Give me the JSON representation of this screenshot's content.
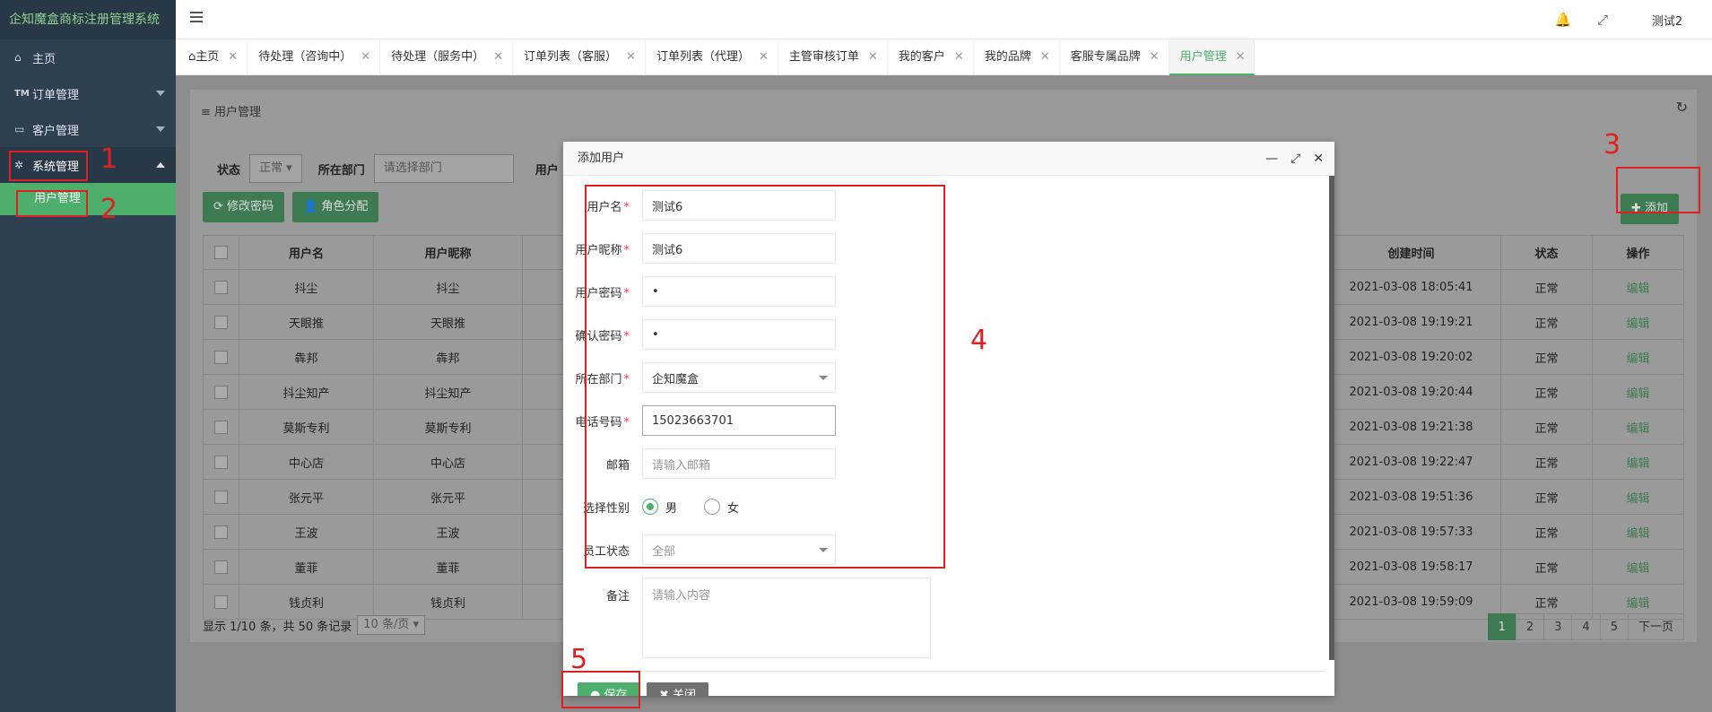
{
  "app": {
    "title": "企知魔盒商标注册管理系统"
  },
  "sidebar": {
    "items": [
      {
        "label": "主页",
        "icon": "home-icon"
      },
      {
        "label": "订单管理",
        "icon": "tm-icon",
        "glyph": "TM"
      },
      {
        "label": "客户管理",
        "icon": "monitor-icon"
      },
      {
        "label": "系统管理",
        "icon": "gear-icon"
      }
    ],
    "subitems": [
      {
        "label": "用户管理"
      }
    ]
  },
  "topbar": {
    "user": "测试2",
    "icons": [
      "bell-icon",
      "fullscreen-icon"
    ]
  },
  "tabs": [
    {
      "label": "主页",
      "icon": "home-icon"
    },
    {
      "label": "待处理（咨询中）"
    },
    {
      "label": "待处理（服务中）"
    },
    {
      "label": "订单列表（客服）"
    },
    {
      "label": "订单列表（代理）"
    },
    {
      "label": "主管审核订单"
    },
    {
      "label": "我的客户"
    },
    {
      "label": "我的品牌"
    },
    {
      "label": "客服专属品牌"
    },
    {
      "label": "用户管理",
      "active": true
    }
  ],
  "panel": {
    "title": "用户管理",
    "filters": {
      "status_label": "状态",
      "status_value": "正常",
      "dept_label": "所在部门",
      "dept_placeholder": "请选择部门",
      "user_label": "用户"
    },
    "buttons": {
      "change_password": "修改密码",
      "assign_role": "角色分配",
      "add": "添加"
    },
    "table": {
      "headers": {
        "username": "用户名",
        "nickname": "用户昵称",
        "created": "创建时间",
        "status": "状态",
        "action": "操作"
      },
      "rows": [
        {
          "username": "抖尘",
          "nickname": "抖尘",
          "created": "2021-03-08 18:05:41",
          "status": "正常",
          "action": "编辑"
        },
        {
          "username": "天眼推",
          "nickname": "天眼推",
          "created": "2021-03-08 19:19:21",
          "status": "正常",
          "action": "编辑"
        },
        {
          "username": "犇邦",
          "nickname": "犇邦",
          "created": "2021-03-08 19:20:02",
          "status": "正常",
          "action": "编辑"
        },
        {
          "username": "抖尘知产",
          "nickname": "抖尘知产",
          "created": "2021-03-08 19:20:44",
          "status": "正常",
          "action": "编辑"
        },
        {
          "username": "莫斯专利",
          "nickname": "莫斯专利",
          "created": "2021-03-08 19:21:38",
          "status": "正常",
          "action": "编辑"
        },
        {
          "username": "中心店",
          "nickname": "中心店",
          "created": "2021-03-08 19:22:47",
          "status": "正常",
          "action": "编辑"
        },
        {
          "username": "张元平",
          "nickname": "张元平",
          "created": "2021-03-08 19:51:36",
          "status": "正常",
          "action": "编辑"
        },
        {
          "username": "王波",
          "nickname": "王波",
          "created": "2021-03-08 19:57:33",
          "status": "正常",
          "action": "编辑"
        },
        {
          "username": "董菲",
          "nickname": "董菲",
          "created": "2021-03-08 19:58:17",
          "status": "正常",
          "action": "编辑"
        },
        {
          "username": "钱贞利",
          "nickname": "钱贞利",
          "created": "2021-03-08 19:59:09",
          "status": "正常",
          "action": "编辑"
        }
      ]
    },
    "footer": {
      "info": "显示 1/10 条，共 50 条记录",
      "page_size": "10 条/页"
    },
    "pager": [
      "1",
      "2",
      "3",
      "4",
      "5",
      "下一页"
    ]
  },
  "modal": {
    "title": "添加用户",
    "fields": {
      "username": {
        "label": "用户名",
        "value": "测试6"
      },
      "nickname": {
        "label": "用户昵称",
        "value": "测试6"
      },
      "password": {
        "label": "用户密码",
        "value": "•"
      },
      "confirm": {
        "label": "确认密码",
        "value": "•"
      },
      "dept": {
        "label": "所在部门",
        "value": "企知魔盒"
      },
      "phone": {
        "label": "电话号码",
        "value": "15023663701"
      },
      "email": {
        "label": "邮箱",
        "placeholder": "请输入邮箱"
      },
      "gender": {
        "label": "选择性别",
        "male": "男",
        "female": "女"
      },
      "emp_status": {
        "label": "员工状态",
        "value": "全部"
      },
      "remark": {
        "label": "备注",
        "placeholder": "请输入内容"
      }
    },
    "buttons": {
      "save": "保存",
      "close": "关闭"
    }
  },
  "annotations": [
    "1",
    "2",
    "3",
    "4",
    "5"
  ],
  "colors": {
    "sidebar": "#2f4050",
    "accent": "#4daf6b",
    "annotation": "#e02020"
  }
}
